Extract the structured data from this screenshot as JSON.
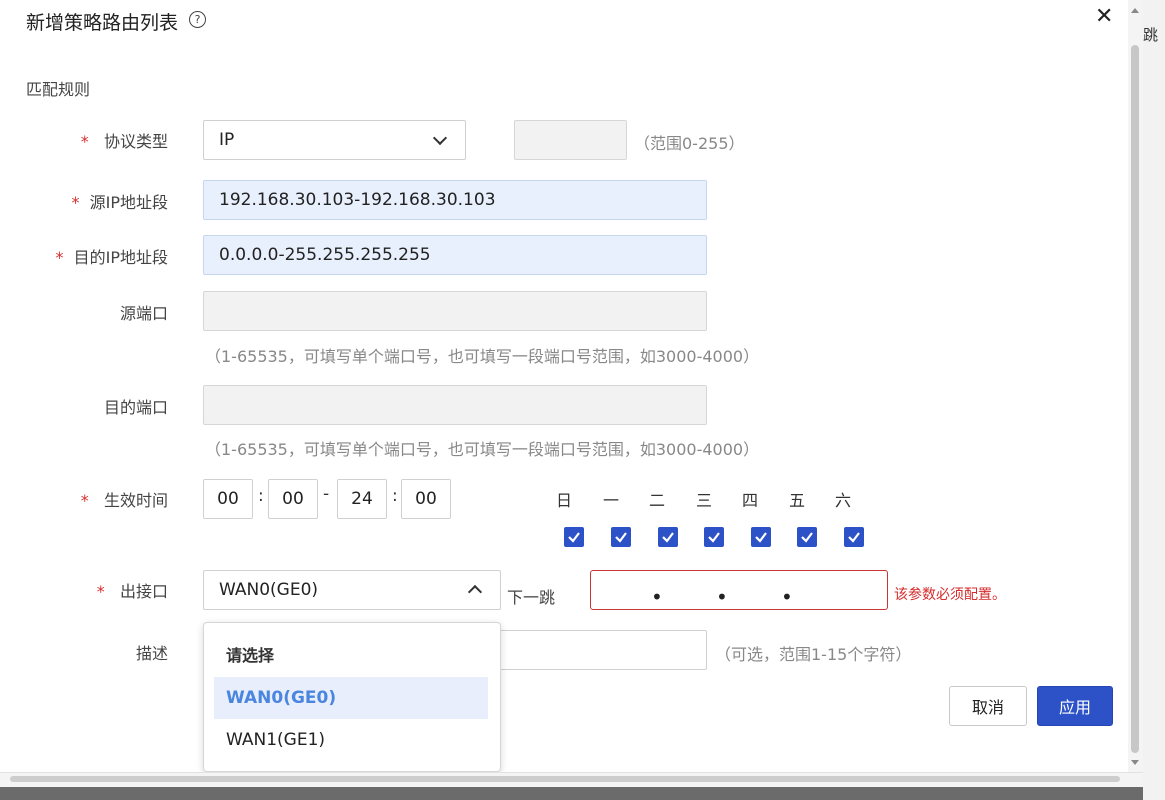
{
  "background": {
    "side_text": "跳"
  },
  "modal": {
    "title": "新增策略路由列表",
    "help_glyph": "?",
    "close_glyph": "✕",
    "section_label": "匹配规则"
  },
  "required_mark": "*",
  "fields": {
    "protocol": {
      "label": "协议类型",
      "value": "IP",
      "extra_hint": "（范围0-255）"
    },
    "src_ip": {
      "label": "源IP地址段",
      "value": "192.168.30.103-192.168.30.103"
    },
    "dst_ip": {
      "label": "目的IP地址段",
      "value": "0.0.0.0-255.255.255.255"
    },
    "src_port": {
      "label": "源端口",
      "value": "",
      "hint": "（1-65535，可填写单个端口号，也可填写一段端口号范围，如3000-4000）"
    },
    "dst_port": {
      "label": "目的端口",
      "value": "",
      "hint": "（1-65535，可填写单个端口号，也可填写一段端口号范围，如3000-4000）"
    },
    "time": {
      "label": "生效时间",
      "start_h": "00",
      "start_m": "00",
      "end_h": "24",
      "end_m": "00",
      "colon": ":",
      "dash": "-",
      "days": [
        "日",
        "一",
        "二",
        "三",
        "四",
        "五",
        "六"
      ],
      "days_checked": [
        true,
        true,
        true,
        true,
        true,
        true,
        true
      ]
    },
    "out_iface": {
      "label": "出接口",
      "value": "WAN0(GE0)",
      "next_hop_label": "下一跳",
      "next_hop_dots": "•",
      "error": "该参数必须配置。",
      "options": [
        "请选择",
        "WAN0(GE0)",
        "WAN1(GE1)"
      ]
    },
    "desc": {
      "label": "描述",
      "hint": "（可选，范围1-15个字符）"
    }
  },
  "buttons": {
    "cancel": "取消",
    "apply": "应用"
  },
  "colors": {
    "primary": "#2d52c8",
    "error": "#d62b2b",
    "filled_bg": "#e8f0fd"
  }
}
